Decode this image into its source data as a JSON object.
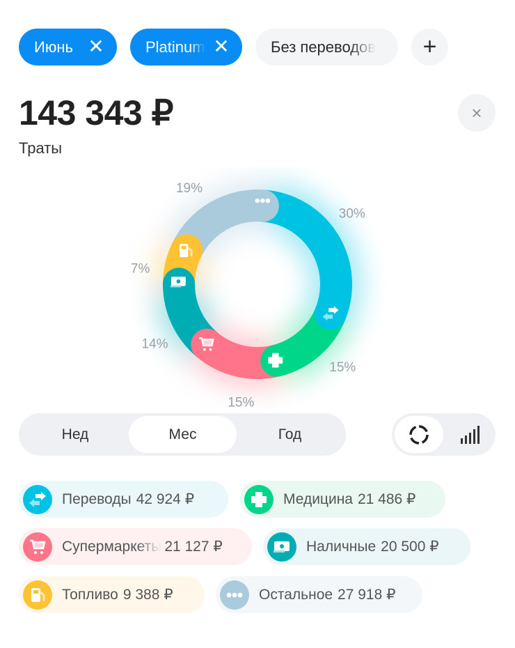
{
  "filters": [
    {
      "label": "Июнь",
      "active": true
    },
    {
      "label": "Platinum",
      "active": true
    },
    {
      "label": "Без переводов",
      "active": false
    }
  ],
  "add_filter": "+",
  "total": {
    "amount": "143 343 ₽",
    "label": "Траты"
  },
  "close": "×",
  "period": {
    "options": [
      "Нед",
      "Мес",
      "Год"
    ],
    "selected": "Мес"
  },
  "view_toggle": {
    "selected": "donut",
    "options": [
      "donut-icon",
      "bar-chart-icon"
    ]
  },
  "categories": [
    {
      "name": "Переводы",
      "amount": "42 924 ₽",
      "percent": 30,
      "percent_label": "30%",
      "color": "#00c3e3",
      "bg": "#eaf8fc",
      "icon": "transfer-icon"
    },
    {
      "name": "Медицина",
      "amount": "21 486 ₽",
      "percent": 15,
      "percent_label": "15%",
      "color": "#00d68a",
      "bg": "#e9f9f1",
      "icon": "medical-cross-icon"
    },
    {
      "name": "Супермаркеты",
      "amount": "21 127 ₽",
      "percent": 15,
      "percent_label": "15%",
      "color": "#ff7489",
      "bg": "#fff0f2",
      "icon": "cart-icon"
    },
    {
      "name": "Наличные",
      "amount": "20 500 ₽",
      "percent": 14,
      "percent_label": "14%",
      "color": "#00adb5",
      "bg": "#eaf6f7",
      "icon": "cash-icon"
    },
    {
      "name": "Топливо",
      "amount": "9 388 ₽",
      "percent": 7,
      "percent_label": "7%",
      "color": "#ffc233",
      "bg": "#fff8ea",
      "icon": "fuel-icon"
    },
    {
      "name": "Остальное",
      "amount": "27 918 ₽",
      "percent": 19,
      "percent_label": "19%",
      "color": "#a9cbdb",
      "bg": "#f3f7f9",
      "icon": "more-dots-icon"
    }
  ]
}
